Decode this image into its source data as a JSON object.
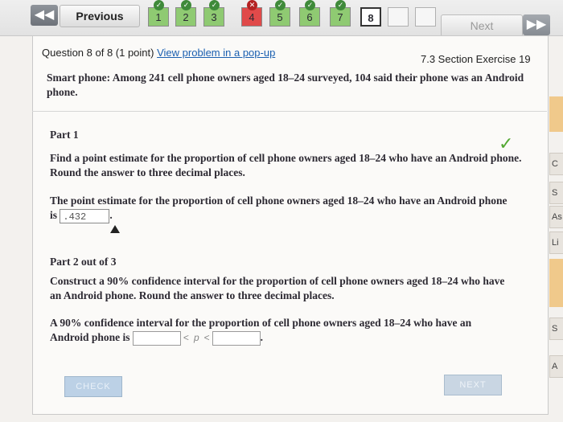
{
  "nav": {
    "previous": "Previous",
    "next": "Next",
    "questions": [
      {
        "num": "1",
        "state": "green",
        "badge": "check"
      },
      {
        "num": "2",
        "state": "green",
        "badge": "check"
      },
      {
        "num": "3",
        "state": "green",
        "badge": "check"
      },
      {
        "num": "4",
        "state": "red",
        "badge": "x"
      },
      {
        "num": "5",
        "state": "green",
        "badge": "check"
      },
      {
        "num": "6",
        "state": "green",
        "badge": "check"
      },
      {
        "num": "7",
        "state": "green",
        "badge": "check"
      },
      {
        "num": "8",
        "state": "current",
        "badge": ""
      }
    ]
  },
  "question": {
    "header": "Question 8 of 8 (1 point)",
    "popup_link": "View problem in a pop-up",
    "section": "7.3 Section Exercise 19",
    "stem": "Smart phone: Among 241 cell phone owners aged 18–24 surveyed, 104 said their phone was an Android phone."
  },
  "part1": {
    "title": "Part 1",
    "instruction": "Find a point estimate for the proportion of cell phone owners aged 18–24 who have an Android phone. Round the answer to three decimal places.",
    "answer_prefix": "The point estimate for the proportion of cell phone owners aged 18–24 who have an Android phone is",
    "answer_value": ".432",
    "answer_suffix": "."
  },
  "part2": {
    "title": "Part 2 out of 3",
    "instruction": "Construct a 90% confidence interval for the proportion of cell phone owners aged 18–24 who have an Android phone. Round the answer to three decimal places.",
    "answer_prefix": "A 90% confidence interval for the proportion of cell phone owners aged 18–24 who have an Android phone is",
    "lower_value": "",
    "ineq_left": "<",
    "variable": "p",
    "ineq_right": "<",
    "upper_value": "",
    "answer_suffix": "."
  },
  "buttons": {
    "check": "CHECK",
    "next": "NEXT"
  },
  "side_tabs": [
    "C",
    "S",
    "As",
    "Li",
    "S",
    "A"
  ],
  "colors": {
    "correct_green": "#8fca72",
    "incorrect_red": "#e04a4a",
    "link_blue": "#1a5fb0",
    "checkmark": "#53a832"
  }
}
